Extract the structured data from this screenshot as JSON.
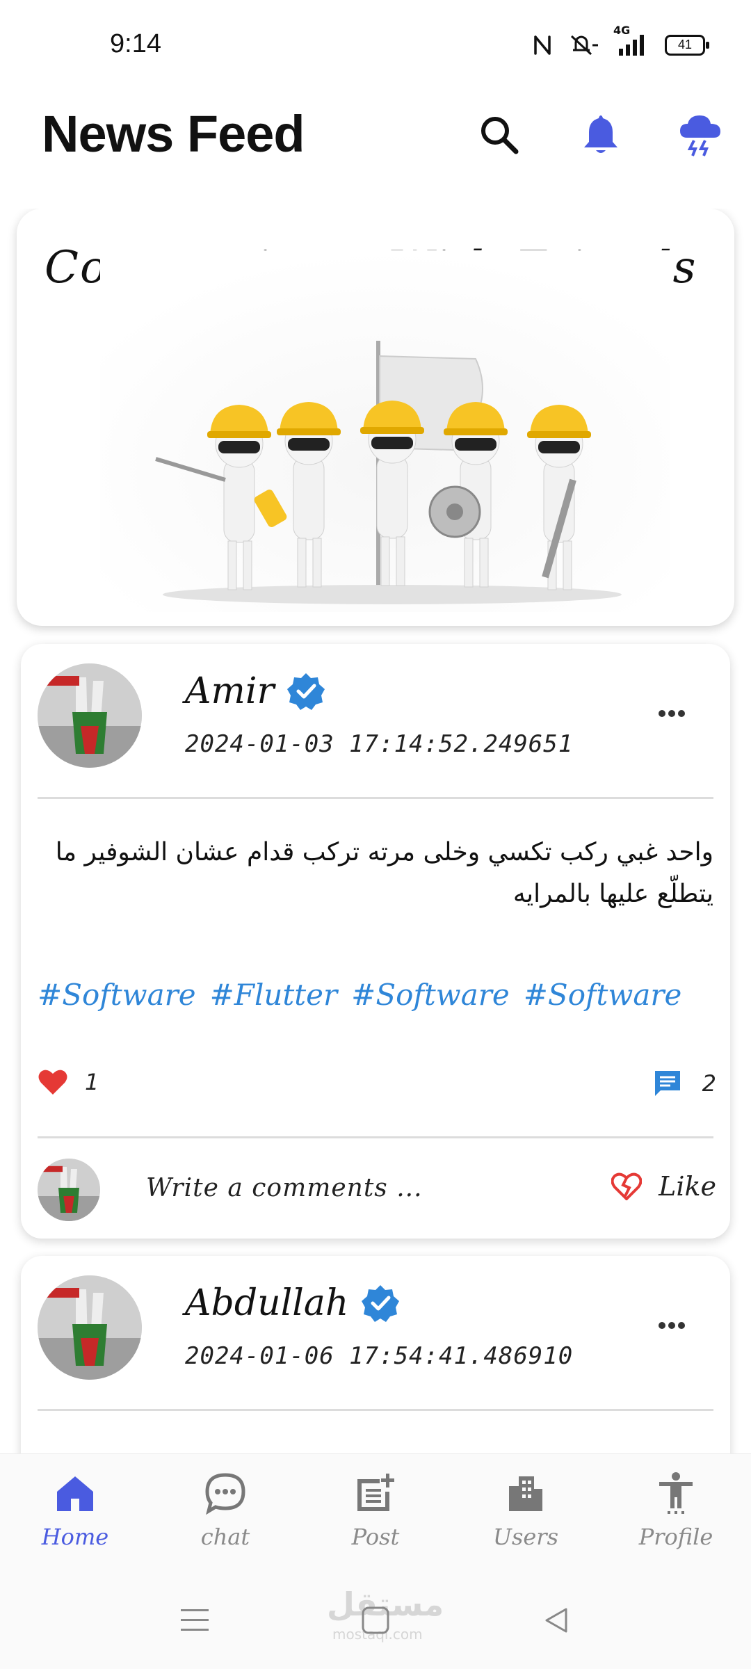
{
  "status_bar": {
    "time": "9:14",
    "network": "4G",
    "battery": "41"
  },
  "header": {
    "title": "News Feed",
    "icons": [
      "search-icon",
      "bell-icon",
      "weather-storm-icon"
    ]
  },
  "banner": {
    "title": "Communicate With Friends"
  },
  "posts": [
    {
      "author": "Amir",
      "timestamp": "2024-01-03 17:14:52.249651",
      "text": "واحد غبي ركب تكسي وخلى مرته تركب قدام عشان الشوفير ما يتطلّع عليها بالمرايه",
      "hashtags": [
        "#Software",
        "#Flutter",
        "#Software",
        "#Software"
      ],
      "likes": "1",
      "comments": "2",
      "comment_placeholder": "Write a comments ...",
      "like_label": "Like"
    },
    {
      "author": "Abdullah",
      "timestamp": "2024-01-06 17:54:41.486910"
    }
  ],
  "bottom_nav": [
    {
      "label": "Home",
      "icon": "home-icon",
      "active": true
    },
    {
      "label": "chat",
      "icon": "chat-icon",
      "active": false
    },
    {
      "label": "Post",
      "icon": "post-add-icon",
      "active": false
    },
    {
      "label": "Users",
      "icon": "building-icon",
      "active": false
    },
    {
      "label": "Profile",
      "icon": "person-icon",
      "active": false
    }
  ],
  "colors": {
    "accent": "#4a5be0",
    "verified": "#2f86d8",
    "heart": "#e53935",
    "hashtag": "#2f86d8"
  },
  "watermark": {
    "text": "مستقل",
    "sub": "mostaql.com"
  }
}
